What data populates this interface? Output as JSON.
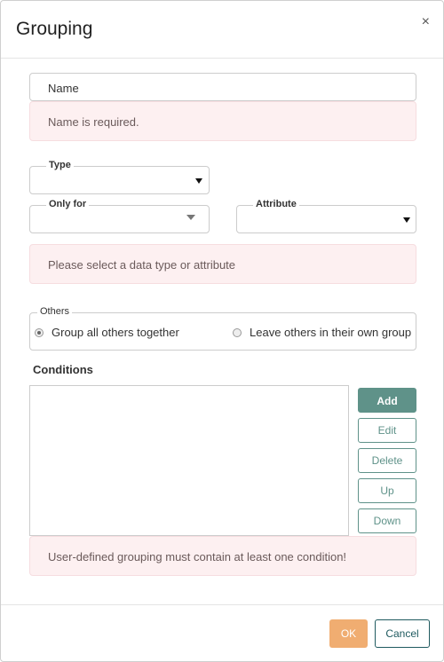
{
  "dialog": {
    "title": "Grouping",
    "close_label": "×"
  },
  "name_field": {
    "value": "Name"
  },
  "errors": {
    "name": "Name is required.",
    "type_attribute": "Please select a data type or attribute",
    "conditions": "User-defined grouping must contain at least one condition!"
  },
  "type_select": {
    "label": "Type",
    "value": ""
  },
  "only_for_select": {
    "label": "Only for",
    "value": ""
  },
  "attribute_select": {
    "label": "Attribute",
    "value": ""
  },
  "others": {
    "legend": "Others",
    "options": [
      {
        "label": "Group all others together",
        "selected": true
      },
      {
        "label": "Leave others in their own group",
        "selected": false
      }
    ]
  },
  "conditions": {
    "title": "Conditions",
    "items": [],
    "buttons": {
      "add": "Add",
      "edit": "Edit",
      "delete": "Delete",
      "up": "Up",
      "down": "Down"
    }
  },
  "footer": {
    "ok": "OK",
    "cancel": "Cancel"
  },
  "colors": {
    "accent": "#5f9289",
    "ok": "#f0ad71",
    "error_bg": "#fdf0f1",
    "cancel_border": "#1f5a5f"
  }
}
